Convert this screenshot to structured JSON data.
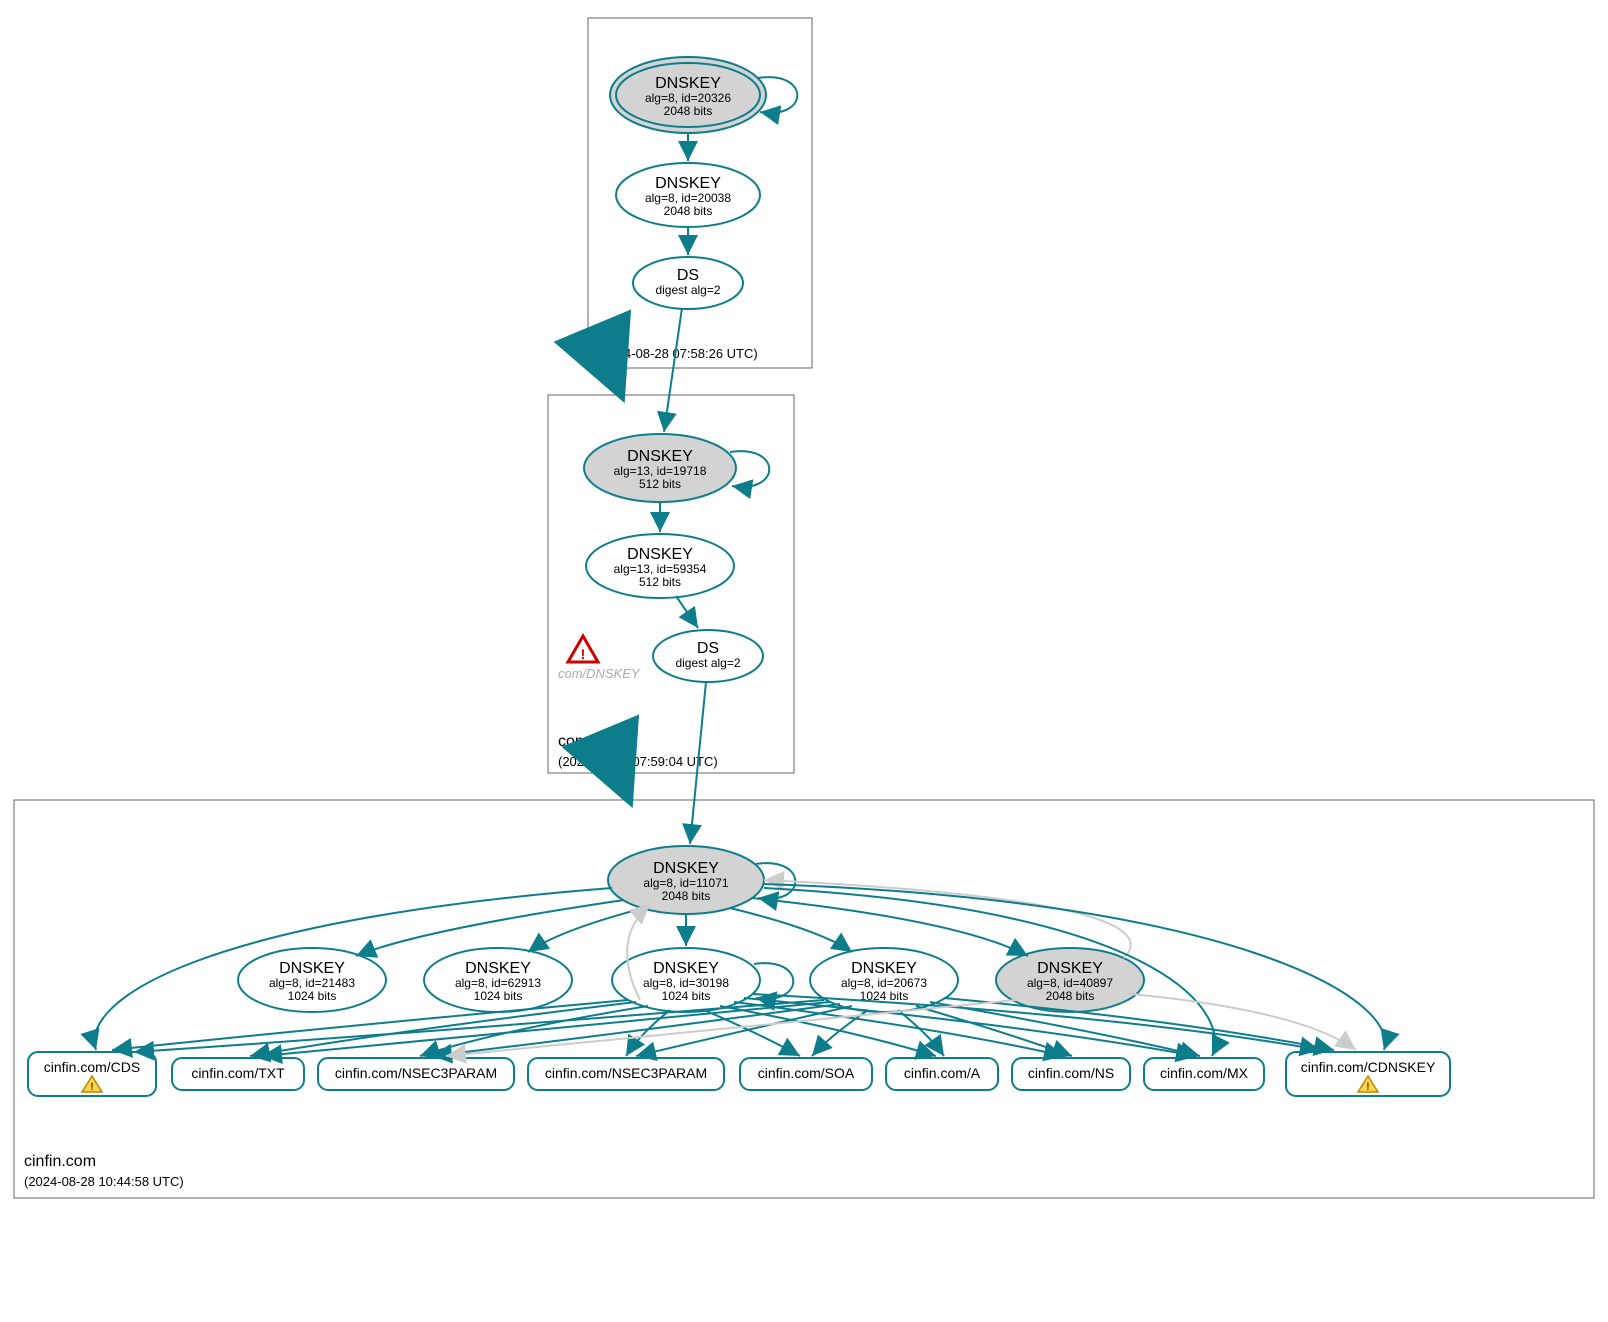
{
  "zones": {
    "root": {
      "name": ".",
      "timestamp": "(2024-08-28 07:58:26 UTC)"
    },
    "com": {
      "name": "com",
      "timestamp": "(2024-08-28 07:59:04 UTC)"
    },
    "leaf": {
      "name": "cinfin.com",
      "timestamp": "(2024-08-28 10:44:58 UTC)"
    }
  },
  "nodes": {
    "root_ksk": {
      "title": "DNSKEY",
      "line2": "alg=8, id=20326",
      "line3": "2048 bits"
    },
    "root_zsk": {
      "title": "DNSKEY",
      "line2": "alg=8, id=20038",
      "line3": "2048 bits"
    },
    "root_ds": {
      "title": "DS",
      "line2": "digest alg=2"
    },
    "com_ksk": {
      "title": "DNSKEY",
      "line2": "alg=13, id=19718",
      "line3": "512 bits"
    },
    "com_zsk": {
      "title": "DNSKEY",
      "line2": "alg=13, id=59354",
      "line3": "512 bits"
    },
    "com_ds": {
      "title": "DS",
      "line2": "digest alg=2"
    },
    "com_warn": {
      "text": "com/DNSKEY"
    },
    "leaf_ksk": {
      "title": "DNSKEY",
      "line2": "alg=8, id=11071",
      "line3": "2048 bits"
    },
    "leaf_k1": {
      "title": "DNSKEY",
      "line2": "alg=8, id=21483",
      "line3": "1024 bits"
    },
    "leaf_k2": {
      "title": "DNSKEY",
      "line2": "alg=8, id=62913",
      "line3": "1024 bits"
    },
    "leaf_k3": {
      "title": "DNSKEY",
      "line2": "alg=8, id=30198",
      "line3": "1024 bits"
    },
    "leaf_k4": {
      "title": "DNSKEY",
      "line2": "alg=8, id=20673",
      "line3": "1024 bits"
    },
    "leaf_k5": {
      "title": "DNSKEY",
      "line2": "alg=8, id=40897",
      "line3": "2048 bits"
    }
  },
  "records": {
    "r0": "cinfin.com/CDS",
    "r1": "cinfin.com/TXT",
    "r2": "cinfin.com/NSEC3PARAM",
    "r3": "cinfin.com/NSEC3PARAM",
    "r4": "cinfin.com/SOA",
    "r5": "cinfin.com/A",
    "r6": "cinfin.com/NS",
    "r7": "cinfin.com/MX",
    "r8": "cinfin.com/CDNSKEY"
  }
}
